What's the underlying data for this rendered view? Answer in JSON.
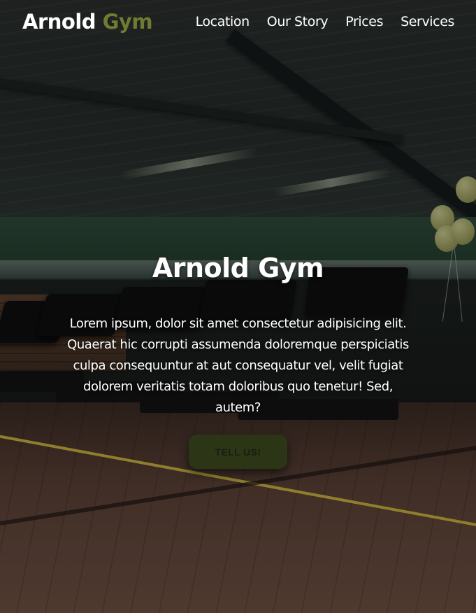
{
  "brand": {
    "name_main": "Arnold",
    "name_accent": "Gym",
    "accent_color": "#6f7a32"
  },
  "nav": {
    "items": [
      {
        "label": "Location"
      },
      {
        "label": "Our Story"
      },
      {
        "label": "Prices"
      },
      {
        "label": "Services"
      }
    ]
  },
  "hero": {
    "title": "Arnold Gym",
    "text": "Lorem ipsum, dolor sit amet consectetur adipisicing elit. Quaerat hic corrupti assumenda doloremque perspiciatis culpa consequuntur at aut consequatur vel, velit fugiat dolorem veritatis totam doloribus quo tenetur! Sed, autem?",
    "cta_label": "TELL US!",
    "cta_color": "#2d3517",
    "background_image": "gym interior with treadmills and wooden floor"
  }
}
